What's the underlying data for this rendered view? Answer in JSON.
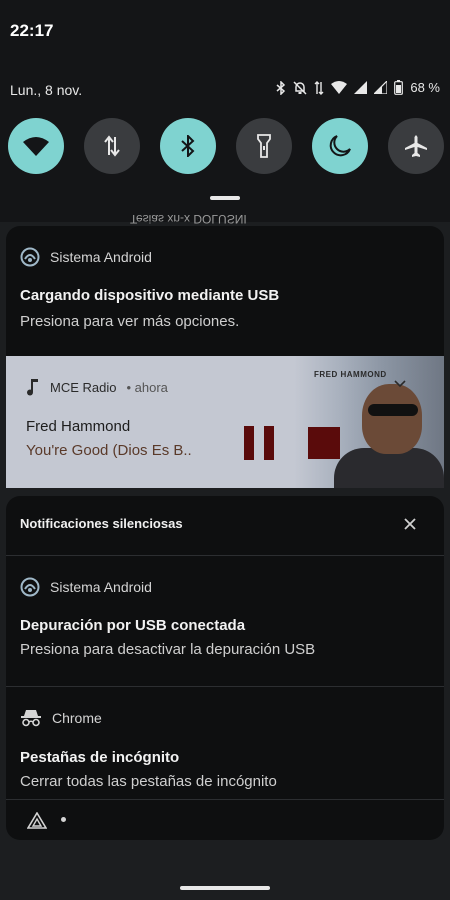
{
  "status_bar": {
    "time": "22:17",
    "date": "Lun., 8 nov.",
    "battery": "68 %"
  },
  "quick_settings": [
    {
      "name": "wifi",
      "state": "on"
    },
    {
      "name": "mobile-data",
      "state": "off"
    },
    {
      "name": "bluetooth",
      "state": "on"
    },
    {
      "name": "flashlight",
      "state": "off"
    },
    {
      "name": "dark-mode",
      "state": "on"
    },
    {
      "name": "airplane-mode",
      "state": "off"
    }
  ],
  "colors": {
    "accent_on": "#7fd3d0",
    "tile_off": "#3a3c3f",
    "card_bg": "#0e0f10",
    "media_controls": "#5a0b0b"
  },
  "notifications": {
    "usb_charging": {
      "app": "Sistema Android",
      "title": "Cargando dispositivo mediante USB",
      "text": "Presiona para ver más opciones."
    },
    "media": {
      "app": "MCE Radio",
      "time": "• ahora",
      "artist": "Fred Hammond",
      "song": "You're Good (Dios Es B..",
      "art_text": "FRED HAMMOND"
    },
    "silent_header": "Notificaciones silenciosas",
    "usb_debugging": {
      "app": "Sistema Android",
      "title": "Depuración por USB conectada",
      "text": "Presiona para desactivar la depuración USB"
    },
    "chrome": {
      "app": "Chrome",
      "title": "Pestañas de incógnito",
      "text": "Cerrar todas las pestañas de incógnito"
    },
    "ghost_text": "Tesias xn-x DOLUSNI"
  }
}
